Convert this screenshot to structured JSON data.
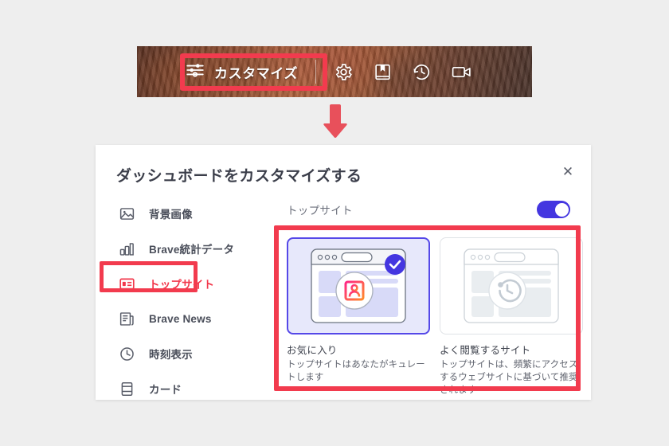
{
  "hero": {
    "customize_label": "カスタマイズ",
    "customize_icon": "sliders-icon",
    "icons": [
      "gear-icon",
      "bookmarks-icon",
      "history-clock-icon",
      "video-camera-icon"
    ],
    "highlight_color": "#f23b4e"
  },
  "arrow": {
    "name": "down-arrow",
    "color": "#e8505b"
  },
  "dialog": {
    "title": "ダッシュボードをカスタマイズする",
    "close_label": "✕"
  },
  "sidebar": {
    "items": [
      {
        "label": "背景画像",
        "icon": "image-icon",
        "active": false
      },
      {
        "label": "Brave統計データ",
        "icon": "bar-chart-icon",
        "active": false
      },
      {
        "label": "トップサイト",
        "icon": "top-sites-icon",
        "active": true
      },
      {
        "label": "Brave News",
        "icon": "news-icon",
        "active": false
      },
      {
        "label": "時刻表示",
        "icon": "clock-icon",
        "active": false
      },
      {
        "label": "カード",
        "icon": "cards-icon",
        "active": false
      }
    ]
  },
  "panel": {
    "title": "トップサイト",
    "toggle": {
      "name": "top-sites-toggle",
      "on": true,
      "color": "#4436e0"
    },
    "cards": [
      {
        "name": "お気に入り",
        "desc": "トップサイトはあなたがキュレートします",
        "selected": true,
        "illustration": "browser-favorites-illustration",
        "check_badge": "check-icon"
      },
      {
        "name": "よく閲覧するサイト",
        "desc": "トップサイトは、頻繁にアクセスするウェブサイトに基づいて推奨されます",
        "selected": false,
        "illustration": "browser-history-illustration",
        "check_badge": null
      }
    ]
  },
  "colors": {
    "page_background": "#eeeeee",
    "highlight_red": "#f23b4e",
    "accent_blue": "#4436e0",
    "title_text": "#3b3e4a"
  }
}
